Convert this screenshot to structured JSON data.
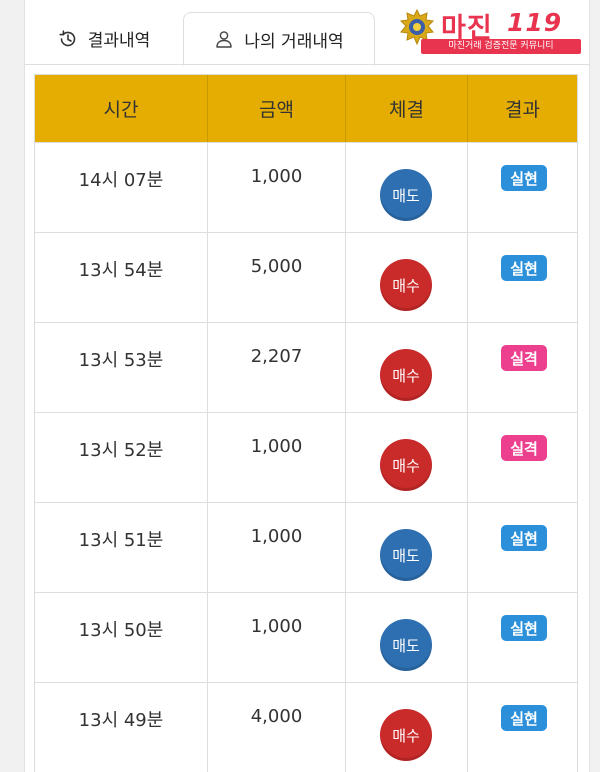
{
  "tabs": {
    "results_label": "결과내역",
    "mine_label": "나의 거래내역",
    "active": "mine"
  },
  "logo": {
    "title": "마진",
    "number": "119",
    "subtitle": "마진거래 검증전문 커뮤니티"
  },
  "colors": {
    "header_bg": "#e5ad02",
    "sell": "#2d6fb0",
    "buy": "#c92a2a",
    "hit": "#2b90d9",
    "miss": "#ec3f8e"
  },
  "table": {
    "headers": {
      "time": "시간",
      "amount": "금액",
      "trade": "체결",
      "result": "결과"
    },
    "rows": [
      {
        "time": "14시 07분",
        "amount": "1,000",
        "trade": "매도",
        "trade_type": "sell",
        "result": "실현",
        "result_type": "hit"
      },
      {
        "time": "13시 54분",
        "amount": "5,000",
        "trade": "매수",
        "trade_type": "buy",
        "result": "실현",
        "result_type": "hit"
      },
      {
        "time": "13시 53분",
        "amount": "2,207",
        "trade": "매수",
        "trade_type": "buy",
        "result": "실격",
        "result_type": "miss"
      },
      {
        "time": "13시 52분",
        "amount": "1,000",
        "trade": "매수",
        "trade_type": "buy",
        "result": "실격",
        "result_type": "miss"
      },
      {
        "time": "13시 51분",
        "amount": "1,000",
        "trade": "매도",
        "trade_type": "sell",
        "result": "실현",
        "result_type": "hit"
      },
      {
        "time": "13시 50분",
        "amount": "1,000",
        "trade": "매도",
        "trade_type": "sell",
        "result": "실현",
        "result_type": "hit"
      },
      {
        "time": "13시 49분",
        "amount": "4,000",
        "trade": "매수",
        "trade_type": "buy",
        "result": "실현",
        "result_type": "hit"
      }
    ]
  }
}
